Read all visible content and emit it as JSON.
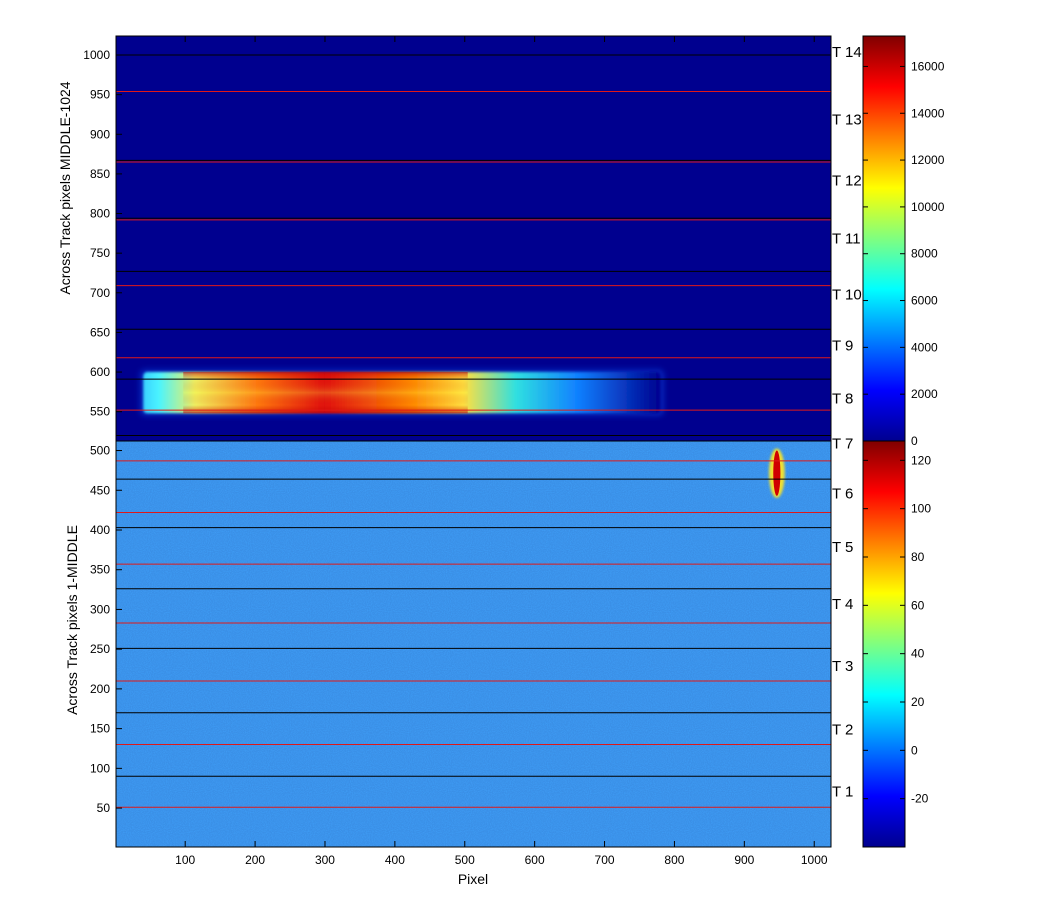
{
  "chart_data": {
    "type": "heatmap",
    "xlabel": "Pixel",
    "x_range": [
      1,
      1024
    ],
    "x_ticks": [
      100,
      200,
      300,
      400,
      500,
      600,
      700,
      800,
      900,
      1000
    ],
    "panels": [
      {
        "ylabel": "Across Track pixels MIDDLE-1024",
        "y_range": [
          513,
          1024
        ],
        "y_ticks": [
          550,
          600,
          650,
          700,
          750,
          800,
          850,
          900,
          950,
          1000
        ],
        "colorbar": {
          "range": [
            0,
            17300
          ],
          "ticks": [
            0,
            2000,
            4000,
            6000,
            8000,
            10000,
            12000,
            14000,
            16000
          ]
        },
        "features": [
          {
            "name": "",
            "x_range": [
              40,
              780
            ],
            "y_range": [
              548,
              600
            ],
            "peak": 16500
          }
        ]
      },
      {
        "ylabel": "Across Track pixels 1-MIDDLE",
        "y_range": [
          1,
          512
        ],
        "y_ticks": [
          50,
          100,
          150,
          200,
          250,
          300,
          350,
          400,
          450,
          500
        ],
        "colorbar": {
          "range": [
            -40,
            128
          ],
          "ticks": [
            -20,
            0,
            20,
            40,
            60,
            80,
            100,
            120
          ]
        },
        "features": [
          {
            "name": "",
            "x_range": [
              938,
              955
            ],
            "y_range": [
              443,
              500
            ],
            "peak": 125
          }
        ]
      }
    ],
    "red_lines_y": [
      51,
      130,
      210,
      283,
      357,
      422,
      487,
      552,
      618,
      709,
      792,
      865,
      954,
      1024
    ],
    "black_lines_y": [
      90,
      170,
      251,
      326,
      403,
      464,
      520,
      591,
      654,
      727,
      794,
      867,
      1000
    ],
    "track_labels": [
      {
        "label": "T 1",
        "y": 72
      },
      {
        "label": "T 2",
        "y": 150
      },
      {
        "label": "T 3",
        "y": 230
      },
      {
        "label": "T 4",
        "y": 308
      },
      {
        "label": "T 5",
        "y": 380
      },
      {
        "label": "T 6",
        "y": 447
      },
      {
        "label": "T 7",
        "y": 510
      },
      {
        "label": "T 8",
        "y": 568
      },
      {
        "label": "T 9",
        "y": 635
      },
      {
        "label": "T 10",
        "y": 699
      },
      {
        "label": "T 11",
        "y": 770
      },
      {
        "label": "T 12",
        "y": 843
      },
      {
        "label": "T 13",
        "y": 920
      },
      {
        "label": "T 14",
        "y": 1005
      }
    ],
    "colors": {
      "background_low": "#00008f",
      "noise_base": "#3a8fe6",
      "red_line": "#e01818",
      "black_line": "#000000"
    },
    "colormap": "jet"
  }
}
